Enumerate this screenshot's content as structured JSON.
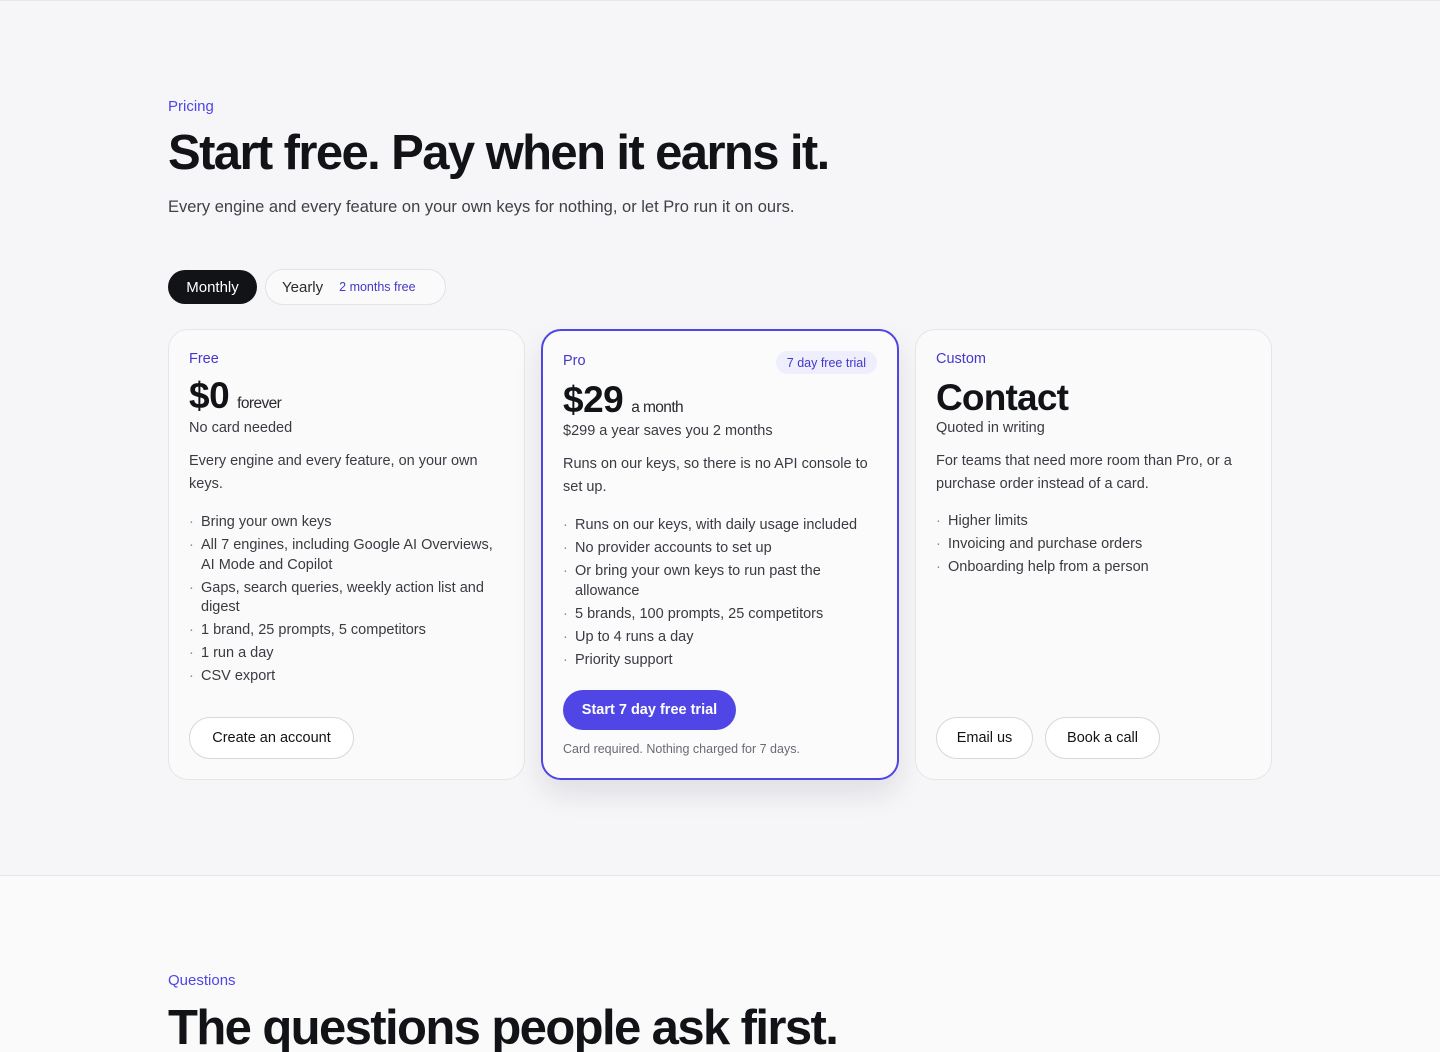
{
  "colors": {
    "accent": "#4f46e5",
    "dark": "#121317",
    "background": "#f6f6f8"
  },
  "pricing": {
    "eyebrow": "Pricing",
    "headline": "Start free. Pay when it earns it.",
    "subtitle": "Every engine and every feature on your own keys for nothing, or let Pro run it on ours.",
    "toggle": {
      "monthly_label": "Monthly",
      "yearly_label": "Yearly",
      "yearly_badge": "2 months free",
      "selected": "Monthly"
    },
    "plans": {
      "free": {
        "tier": "Free",
        "price": "$0",
        "unit": "forever",
        "note": "No card needed",
        "description": "Every engine and every feature, on your own keys.",
        "features": [
          "Bring your own keys",
          "All 7 engines, including Google AI Overviews, AI Mode and Copilot",
          "Gaps, search queries, weekly action list and digest",
          "1 brand, 25 prompts, 5 competitors",
          "1 run a day",
          "CSV export"
        ],
        "cta": "Create an account"
      },
      "pro": {
        "tier": "Pro",
        "badge": "7 day free trial",
        "price": "$29",
        "unit": "a month",
        "note": "$299 a year saves you 2 months",
        "description": "Runs on our keys, so there is no API console to set up.",
        "features": [
          "Runs on our keys, with daily usage included",
          "No provider accounts to set up",
          "Or bring your own keys to run past the allowance",
          "5 brands, 100 prompts, 25 competitors",
          "Up to 4 runs a day",
          "Priority support"
        ],
        "cta": "Start 7 day free trial",
        "fineprint": "Card required. Nothing charged for 7 days."
      },
      "custom": {
        "tier": "Custom",
        "price": "Contact",
        "note": "Quoted in writing",
        "description": "For teams that need more room than Pro, or a purchase order instead of a card.",
        "features": [
          "Higher limits",
          "Invoicing and purchase orders",
          "Onboarding help from a person"
        ],
        "cta_email": "Email us",
        "cta_call": "Book a call"
      }
    }
  },
  "faq": {
    "eyebrow": "Questions",
    "headline": "The questions people ask first."
  }
}
